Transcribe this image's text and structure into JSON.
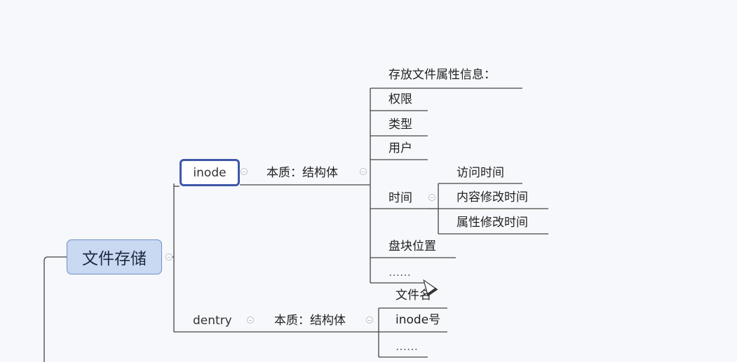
{
  "root": {
    "label": "文件存储"
  },
  "inode": {
    "label": "inode",
    "essence": "本质：结构体",
    "title": "存放文件属性信息：",
    "attributes": [
      "权限",
      "类型",
      "用户"
    ],
    "time": {
      "label": "时间",
      "children": [
        "访问时间",
        "内容修改时间",
        "属性修改时间"
      ]
    },
    "block": "盘块位置",
    "more": "……"
  },
  "dentry": {
    "label": "dentry",
    "essence": "本质：结构体",
    "children": [
      "文件名",
      "inode号",
      "……"
    ]
  }
}
